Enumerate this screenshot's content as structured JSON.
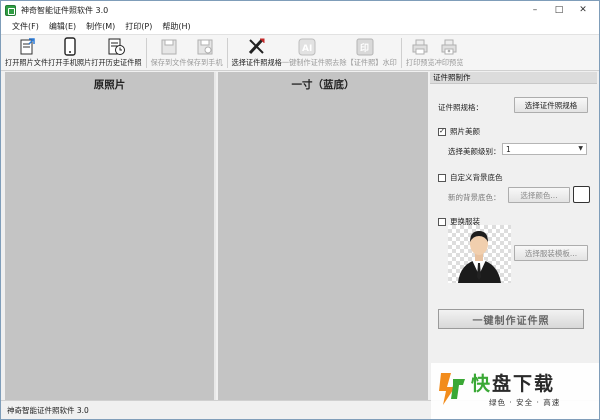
{
  "window": {
    "title": "神奇智能证件照软件 3.0",
    "controls": [
      "–",
      "□",
      "✕"
    ]
  },
  "menu": [
    "文件(F)",
    "编辑(E)",
    "制作(M)",
    "打印(P)",
    "帮助(H)"
  ],
  "toolbar": {
    "open_photo": "打开照片文件",
    "open_phone": "打开手机照片",
    "open_history": "打开历史证件照",
    "save_file": "保存到文件",
    "save_phone": "保存到手机",
    "select_spec": "选择证件照规格",
    "one_click": "一键制作证件照",
    "remove_watermark": "去除【证件照】水印",
    "print_preview": "打印预览",
    "proof_preview": "冲印预览"
  },
  "panels": {
    "original_title": "原照片",
    "result_title": "一寸（蓝底）"
  },
  "settings": {
    "header": "证件照制作",
    "spec_label": "证件照规格：",
    "spec_button": "选择证件照规格",
    "beauty_checkbox": "照片美颜",
    "beauty_checked": true,
    "beauty_level_label": "选择美颜级别：",
    "beauty_level_value": "1",
    "custom_bg_checkbox": "自定义背景底色",
    "custom_bg_checked": false,
    "new_bg_label": "新的背景底色：",
    "choose_color_button": "选择颜色...",
    "swatch_color": "#ffffff",
    "change_outfit_checkbox": "更换服装",
    "change_outfit_checked": false,
    "outfit_template_button": "选择服装模板...",
    "make_button": "一键制作证件照"
  },
  "status": {
    "text": "神奇智能证件照软件 3.0"
  },
  "watermark": {
    "brand_green": "快",
    "brand_rest": "盘下载",
    "slogan": "绿色 · 安全 · 高速",
    "logo_colors": [
      "#f28c1c",
      "#3aa835"
    ]
  }
}
